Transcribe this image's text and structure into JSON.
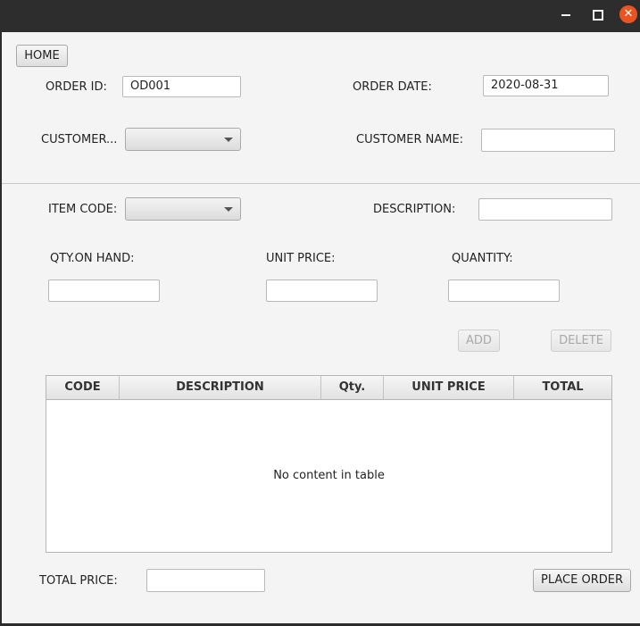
{
  "titlebar": {
    "minimize": "minimize",
    "maximize": "maximize",
    "close": "✕"
  },
  "buttons": {
    "home": "HOME",
    "add": "ADD",
    "delete": "DELETE",
    "place_order": "PLACE ORDER"
  },
  "order": {
    "order_id_label": "ORDER ID:",
    "order_id_value": "OD001",
    "order_date_label": "ORDER DATE:",
    "order_date_value": "2020-08-31",
    "customer_label": "CUSTOMER...",
    "customer_selected": "",
    "customer_name_label": "CUSTOMER NAME:",
    "customer_name_value": ""
  },
  "item": {
    "item_code_label": "ITEM CODE:",
    "item_code_selected": "",
    "description_label": "DESCRIPTION:",
    "description_value": "",
    "qty_on_hand_label": "QTY.ON HAND:",
    "qty_on_hand_value": "",
    "unit_price_label": "UNIT PRICE:",
    "unit_price_value": "",
    "quantity_label": "QUANTITY:",
    "quantity_value": ""
  },
  "table": {
    "columns": [
      "CODE",
      "DESCRIPTION",
      "Qty.",
      "UNIT PRICE",
      "TOTAL"
    ],
    "rows": [],
    "empty_text": "No content in table"
  },
  "footer": {
    "total_price_label": "TOTAL PRICE:",
    "total_price_value": ""
  },
  "colors": {
    "close_button": "#e95420",
    "window_bg": "#f4f4f4",
    "titlebar_bg": "#2d2d2d"
  }
}
